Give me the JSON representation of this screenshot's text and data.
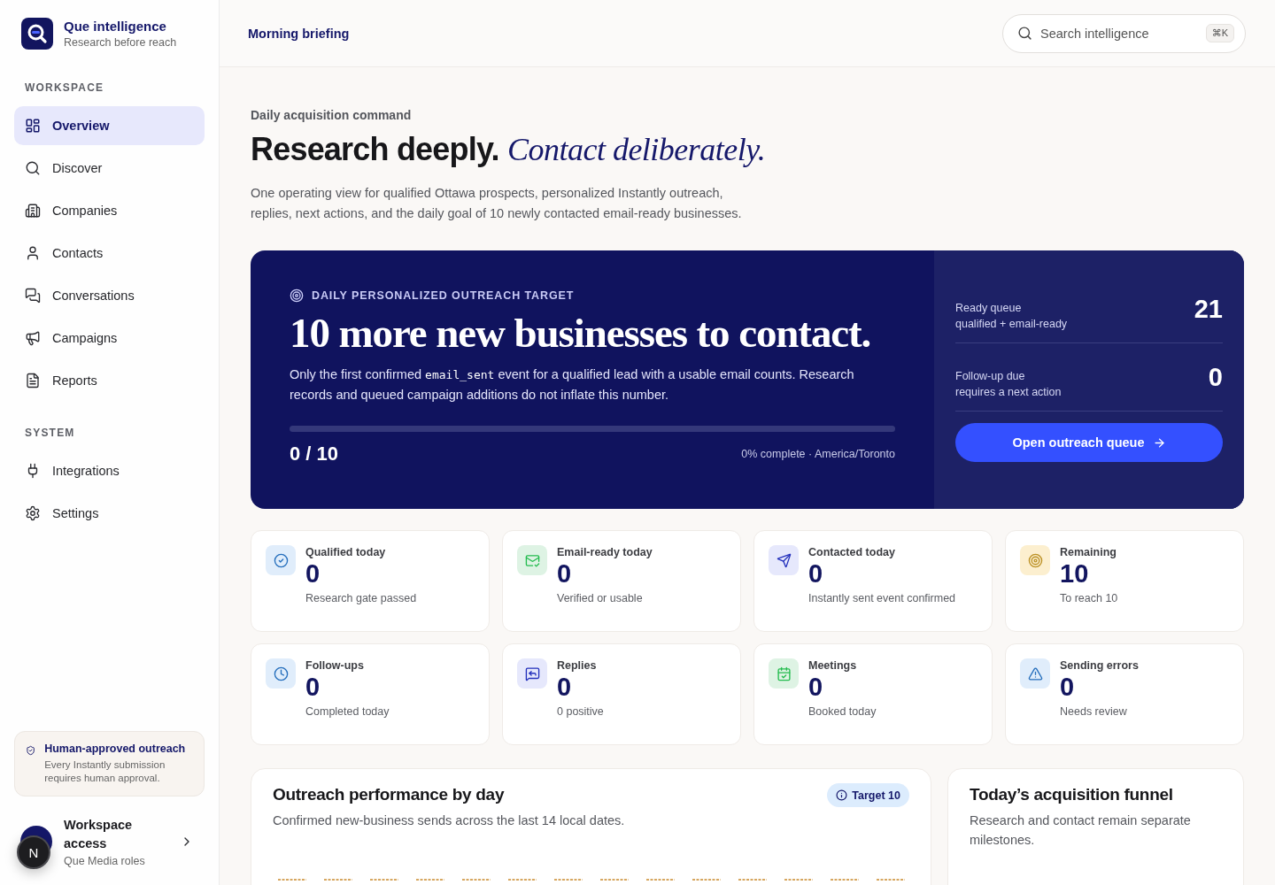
{
  "sidebar": {
    "brand": {
      "name": "Que intelligence",
      "tagline": "Research before reach"
    },
    "sections": [
      {
        "label": "WORKSPACE",
        "items": [
          {
            "label": "Overview",
            "selected": true
          },
          {
            "label": "Discover",
            "selected": false
          },
          {
            "label": "Companies",
            "selected": false
          },
          {
            "label": "Contacts",
            "selected": false
          },
          {
            "label": "Conversations",
            "selected": false
          },
          {
            "label": "Campaigns",
            "selected": false
          },
          {
            "label": "Reports",
            "selected": false
          }
        ]
      },
      {
        "label": "SYSTEM",
        "items": [
          {
            "label": "Integrations",
            "selected": false
          },
          {
            "label": "Settings",
            "selected": false
          }
        ]
      }
    ],
    "notice": {
      "title": "Human-approved outreach",
      "text": "Every Instantly submission requires human approval."
    },
    "account": {
      "title": "Workspace access",
      "subtitle": "Que Media roles"
    },
    "dev_badge": {
      "label": "N"
    }
  },
  "header": {
    "title": "Morning briefing",
    "search": {
      "placeholder": "Search intelligence",
      "shortcut": "⌘K"
    }
  },
  "hero": {
    "eyebrow": "Daily acquisition command",
    "title": "Research deeply. *Contact deliberately.*",
    "description": "One operating view for qualified Ottawa prospects, personalized Instantly outreach, replies, next actions, and the daily goal of 10 newly contacted email-ready businesses."
  },
  "target_banner": {
    "eyebrow": "DAILY PERSONALIZED OUTREACH TARGET",
    "headline": "10 more new businesses to contact.",
    "description": [
      {
        "kind": "text",
        "text": "Only the first confirmed "
      },
      {
        "kind": "code",
        "text": "email_sent"
      },
      {
        "kind": "text",
        "text": " event for a qualified lead with a usable email counts. Research records and queued campaign additions do not inflate this number."
      }
    ],
    "progress": {
      "count": "0 / 10",
      "caption": "0% complete · America/Toronto"
    },
    "queue_stats": [
      {
        "label": "Ready queue",
        "detail": "qualified + email-ready",
        "value": "21"
      },
      {
        "label": "Follow-up due",
        "detail": "requires a next action",
        "value": "0"
      }
    ],
    "button": {
      "label": "Open outreach queue"
    }
  },
  "stats": [
    {
      "title": "Qualified today",
      "value": "0",
      "caption": "Research gate passed",
      "color": "#e0edfb"
    },
    {
      "title": "Email-ready today",
      "value": "0",
      "caption": "Verified or usable",
      "color": "#def3e4"
    },
    {
      "title": "Contacted today",
      "value": "0",
      "caption": "Instantly sent event confirmed",
      "color": "#e6e8fc"
    },
    {
      "title": "Remaining",
      "value": "10",
      "caption": "To reach 10",
      "color": "#fcefcf"
    },
    {
      "title": "Follow-ups",
      "value": "0",
      "caption": "Completed today",
      "color": "#e0edfb"
    },
    {
      "title": "Replies",
      "value": "0",
      "caption": "0 positive",
      "color": "#e6e8fc"
    },
    {
      "title": "Meetings",
      "value": "0",
      "caption": "Booked today",
      "color": "#def3e4"
    },
    {
      "title": "Sending errors",
      "value": "0",
      "caption": "Needs review",
      "color": "#e0edfb"
    }
  ],
  "performance": {
    "title": "Outreach performance by day",
    "subtitle": "Confirmed new-business sends across the last 14 local dates.",
    "badge": "Target 10"
  },
  "funnel": {
    "title": "Today’s acquisition funnel",
    "subtitle": "Research and contact remain separate milestones."
  }
}
